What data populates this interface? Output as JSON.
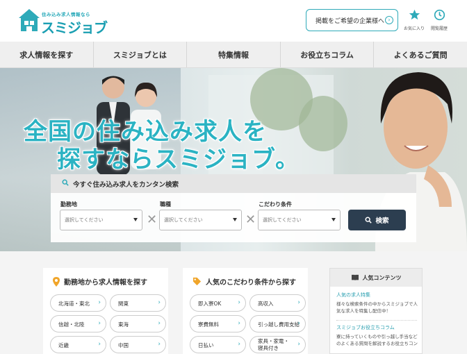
{
  "header": {
    "logo_tagline": "住み込み求人情報なら",
    "logo_name": "スミジョブ",
    "cta_label": "掲載をご希望の企業様へ",
    "favorites_label": "お気に入り",
    "history_label": "閲覧履歴"
  },
  "nav": {
    "items": [
      {
        "label": "求人情報を探す"
      },
      {
        "label": "スミジョブとは"
      },
      {
        "label": "特集情報"
      },
      {
        "label": "お役立ちコラム"
      },
      {
        "label": "よくあるご質問"
      }
    ]
  },
  "hero": {
    "line1": "全国の住み込み求人を",
    "line2": "探すならスミジョブ。"
  },
  "search": {
    "title": "今すぐ住み込み求人をカンタン検索",
    "fields": [
      {
        "label": "勤務地",
        "value": "選択してください"
      },
      {
        "label": "職種",
        "value": "選択してください"
      },
      {
        "label": "こだわり条件",
        "value": "選択してください"
      }
    ],
    "button_label": "検索"
  },
  "area_card": {
    "title": "勤務地から求人情報を探す",
    "chips": [
      "北海道・東北",
      "関東",
      "信越・北陸",
      "東海",
      "近畿",
      "中国"
    ]
  },
  "condition_card": {
    "title": "人気のこだわり条件から探す",
    "chips": [
      "即入寮OK",
      "高収入",
      "寮費無料",
      "引っ越し費用支給",
      "日払い",
      "家具・家電・寝具付き"
    ]
  },
  "popular": {
    "title": "人気コンテンツ",
    "items": [
      {
        "link": "人気の求人特集",
        "text": "様々な検索条件の中からスミジョブで人気な求人を特集し配信中！"
      },
      {
        "link": "スミジョブお役立ちコラム",
        "text": "寮に持っていくものや引っ越し手当などのよくある質問を解説するお役立ちコン"
      }
    ]
  },
  "colors": {
    "accent": "#2eaab9",
    "brand_text": "#1b9fb2",
    "search_button": "#2c3e50"
  }
}
